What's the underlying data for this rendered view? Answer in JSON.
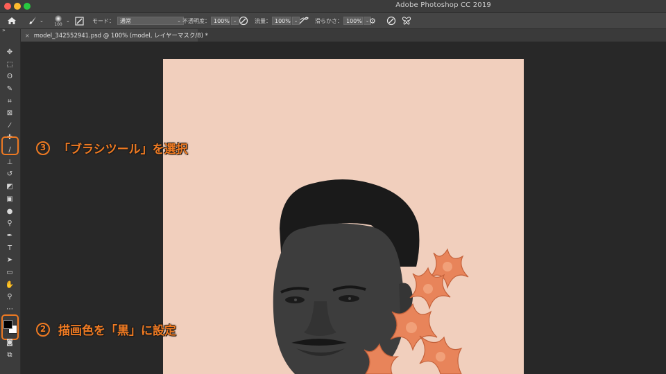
{
  "window": {
    "title": "Adobe Photoshop CC 2019"
  },
  "traffic_lights": [
    {
      "name": "close-button",
      "color": "#fe5f57"
    },
    {
      "name": "minimize-button",
      "color": "#febc2e"
    },
    {
      "name": "zoom-button",
      "color": "#28c840"
    }
  ],
  "options_bar": {
    "brush_size": "100",
    "mode_label": "モード：",
    "mode_value": "通常",
    "opacity_label": "不透明度：",
    "opacity_value": "100%",
    "flow_label": "流量：",
    "flow_value": "100%",
    "smoothing_label": "滑らかさ：",
    "smoothing_value": "100%"
  },
  "document": {
    "tab_title": "model_342552941.psd @ 100% (model, レイヤーマスク/8) *",
    "close_glyph": "×",
    "background_color": "#f1cfbd"
  },
  "toolbar": {
    "collapse_glyph": "»",
    "tools": [
      {
        "name": "move-tool",
        "glyph": "✥"
      },
      {
        "name": "marquee-tool",
        "glyph": "⬚"
      },
      {
        "name": "lasso-tool",
        "glyph": "ʘ"
      },
      {
        "name": "quick-selection-tool",
        "glyph": "✎"
      },
      {
        "name": "crop-tool",
        "glyph": "⌗"
      },
      {
        "name": "frame-tool",
        "glyph": "⊠"
      },
      {
        "name": "eyedropper-tool",
        "glyph": "⁄"
      },
      {
        "name": "healing-brush-tool",
        "glyph": "✚"
      },
      {
        "name": "brush-tool",
        "glyph": "∕"
      },
      {
        "name": "clone-stamp-tool",
        "glyph": "⊥"
      },
      {
        "name": "history-brush-tool",
        "glyph": "↺"
      },
      {
        "name": "eraser-tool",
        "glyph": "◩"
      },
      {
        "name": "gradient-tool",
        "glyph": "▣"
      },
      {
        "name": "blur-tool",
        "glyph": "●"
      },
      {
        "name": "dodge-tool",
        "glyph": "⚲"
      },
      {
        "name": "pen-tool",
        "glyph": "✒"
      },
      {
        "name": "type-tool",
        "glyph": "T"
      },
      {
        "name": "path-selection-tool",
        "glyph": "➤"
      },
      {
        "name": "rectangle-tool",
        "glyph": "▭"
      },
      {
        "name": "hand-tool",
        "glyph": "✋"
      },
      {
        "name": "zoom-tool",
        "glyph": "⚲"
      },
      {
        "name": "more-tools",
        "glyph": "⋯"
      }
    ],
    "foreground_color": "#000000",
    "background_color": "#ffffff"
  },
  "annotations": [
    {
      "number": "3",
      "text": "「ブラシツール」を選択"
    },
    {
      "number": "2",
      "text": "描画色を「黒」に設定"
    }
  ],
  "accent_color": "#ef7a22"
}
